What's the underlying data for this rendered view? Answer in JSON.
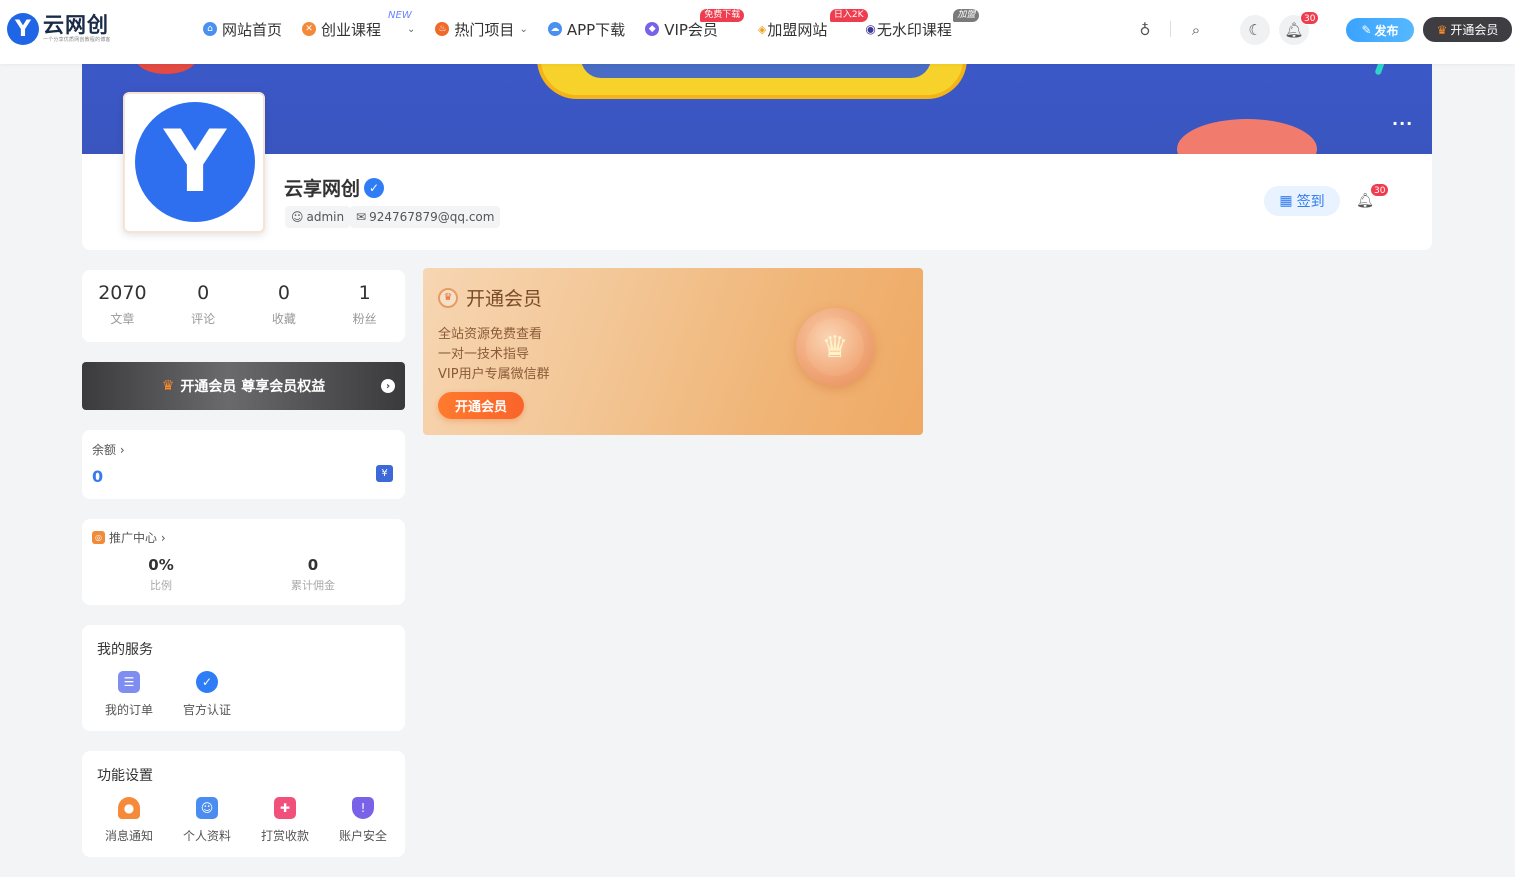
{
  "brand": {
    "logo_letter": "Y",
    "name": "云网创",
    "tagline": "一个分享优质网创教程的博客"
  },
  "nav": [
    {
      "label": "网站首页",
      "icon": "home-icon",
      "color": "#4a90f0"
    },
    {
      "label": "创业课程",
      "icon": "course-icon",
      "color": "#f38a3a",
      "badge": "NEW"
    },
    {
      "label": "热门项目",
      "icon": "fire-icon",
      "color": "#f06a2a"
    },
    {
      "label": "APP下载",
      "icon": "cloud-icon",
      "color": "#4a90f0"
    },
    {
      "label": "VIP会员",
      "icon": "diamond-icon",
      "color": "#7a62e8",
      "badge": "免费下载"
    },
    {
      "label": "加盟网站",
      "icon": "gem-icon",
      "color": "#f0a020",
      "badge": "日入2K"
    },
    {
      "label": "无水印课程",
      "icon": "globe-icon",
      "color": "#3a3a9a",
      "badge": "加盟"
    }
  ],
  "header": {
    "notification_count": "30",
    "publish_label": "发布",
    "vip_label": "开通会员"
  },
  "profile": {
    "name": "云享网创",
    "username": "admin",
    "email": "924767879@qq.com",
    "sign_label": "签到",
    "notification_count": "30",
    "more": "···"
  },
  "stats": [
    {
      "value": "2070",
      "label": "文章"
    },
    {
      "value": "0",
      "label": "评论"
    },
    {
      "value": "0",
      "label": "收藏"
    },
    {
      "value": "1",
      "label": "粉丝"
    }
  ],
  "vip_banner": "开通会员 尊享会员权益",
  "balance": {
    "title": "余额",
    "value": "0"
  },
  "promo": {
    "title": "推广中心",
    "ratio": "0%",
    "ratio_label": "比例",
    "commission": "0",
    "commission_label": "累计佣金"
  },
  "services": {
    "title": "我的服务",
    "items": [
      {
        "label": "我的订单",
        "icon": "order-icon",
        "color": "#7f8cf0"
      },
      {
        "label": "官方认证",
        "icon": "verified-icon",
        "color": "#2e7cf6"
      }
    ]
  },
  "functions": {
    "title": "功能设置",
    "items": [
      {
        "label": "消息通知",
        "icon": "bell-icon",
        "color": "#f58a3a"
      },
      {
        "label": "个人资料",
        "icon": "profile-icon",
        "color": "#4a8cf0"
      },
      {
        "label": "打赏收款",
        "icon": "gift-icon",
        "color": "#f0507a"
      },
      {
        "label": "账户安全",
        "icon": "shield-icon",
        "color": "#7a62e8"
      }
    ]
  },
  "vip_card": {
    "title": "开通会员",
    "lines": [
      "全站资源免费查看",
      "一对一技术指导",
      "VIP用户专属微信群"
    ],
    "button": "开通会员"
  }
}
